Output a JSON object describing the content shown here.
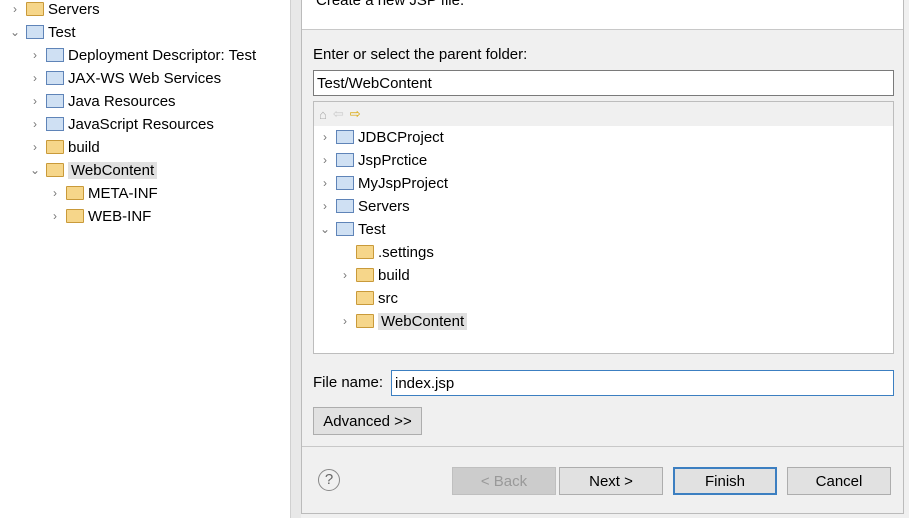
{
  "explorer": {
    "items": [
      {
        "label": "Servers",
        "expanded": false,
        "indent": 0,
        "icon": "folder-icon"
      },
      {
        "label": "Test",
        "expanded": true,
        "indent": 0,
        "icon": "project-icon"
      },
      {
        "label": "Deployment Descriptor: Test",
        "expanded": false,
        "indent": 1,
        "icon": "descriptor-icon"
      },
      {
        "label": "JAX-WS Web Services",
        "expanded": false,
        "indent": 1,
        "icon": "webservice-icon"
      },
      {
        "label": "Java Resources",
        "expanded": false,
        "indent": 1,
        "icon": "java-resources-icon"
      },
      {
        "label": "JavaScript Resources",
        "expanded": false,
        "indent": 1,
        "icon": "javascript-resources-icon"
      },
      {
        "label": "build",
        "expanded": false,
        "indent": 1,
        "icon": "folder-icon"
      },
      {
        "label": "WebContent",
        "expanded": true,
        "indent": 1,
        "icon": "folder-icon",
        "selected": true
      },
      {
        "label": "META-INF",
        "expanded": false,
        "indent": 2,
        "icon": "folder-icon"
      },
      {
        "label": "WEB-INF",
        "expanded": false,
        "indent": 2,
        "icon": "folder-icon"
      }
    ]
  },
  "dialog": {
    "description": "Create a new JSP file.",
    "parent_label": "Enter or select the parent folder:",
    "parent_value": "Test/WebContent",
    "tree": [
      {
        "label": "JDBCProject",
        "indent": 0,
        "chev": ">"
      },
      {
        "label": "JspPrctice",
        "indent": 0,
        "chev": ">"
      },
      {
        "label": "MyJspProject",
        "indent": 0,
        "chev": ">"
      },
      {
        "label": "Servers",
        "indent": 0,
        "chev": ">"
      },
      {
        "label": "Test",
        "indent": 0,
        "chev": "v"
      },
      {
        "label": ".settings",
        "indent": 1,
        "chev": ""
      },
      {
        "label": "build",
        "indent": 1,
        "chev": ">"
      },
      {
        "label": "src",
        "indent": 1,
        "chev": ""
      },
      {
        "label": "WebContent",
        "indent": 1,
        "chev": ">",
        "selected": true
      }
    ],
    "file_label": "File name:",
    "file_value": "index.jsp",
    "advanced": "Advanced >>",
    "back": "< Back",
    "next": "Next >",
    "finish": "Finish",
    "cancel": "Cancel"
  }
}
